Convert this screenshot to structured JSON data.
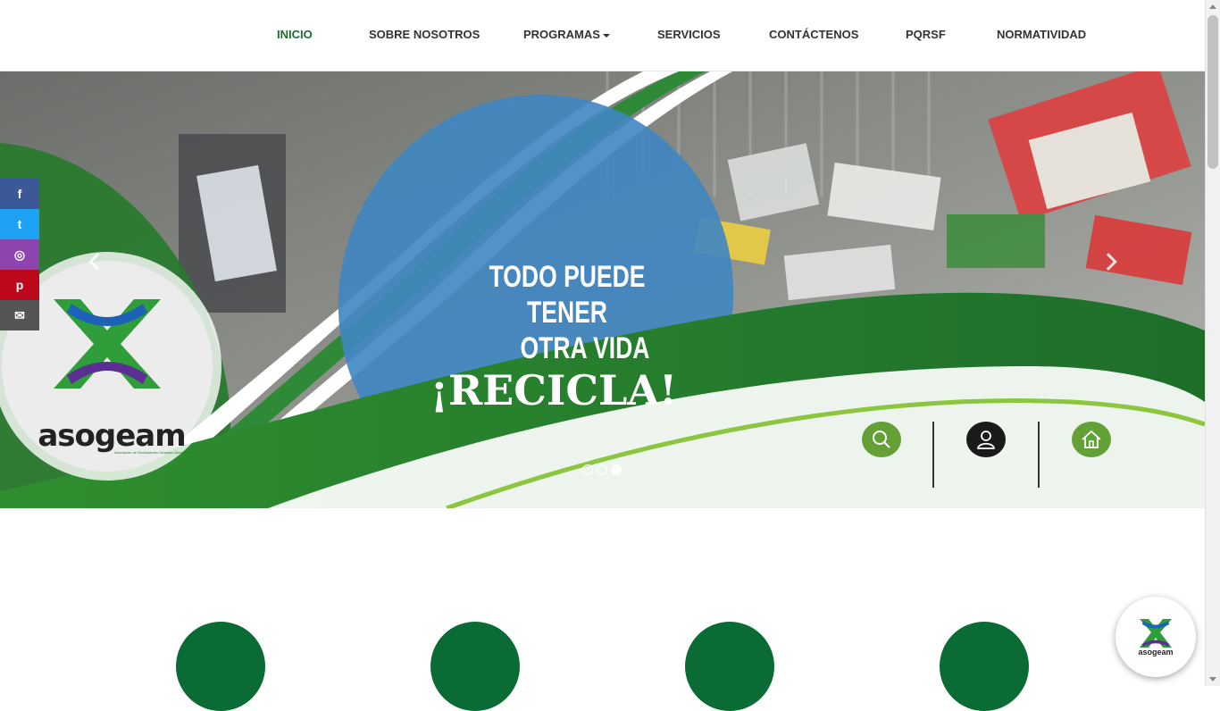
{
  "nav": {
    "items": [
      {
        "label": "INICIO",
        "active": true
      },
      {
        "label": "SOBRE NOSOTROS"
      },
      {
        "label": "PROGRAMAS",
        "dropdown": true
      },
      {
        "label": "SERVICIOS"
      },
      {
        "label": "CONTÁCTENOS"
      },
      {
        "label": "PQRSF"
      },
      {
        "label": "NORMATIVIDAD"
      }
    ]
  },
  "hero": {
    "line1": "TODO PUEDE TENER",
    "line2": "OTRA VIDA",
    "line3": "¡RECICLA!",
    "logo_text": "asogeam",
    "logo_subtitle": "Asociación de Recicladores Gestores Ambientales",
    "slides": 3,
    "active_slide": 3
  },
  "social": [
    {
      "icon": "facebook-icon",
      "glyph": "f",
      "color": "#3b5998"
    },
    {
      "icon": "twitter-icon",
      "glyph": "t",
      "color": "#1da1f2"
    },
    {
      "icon": "instagram-icon",
      "glyph": "◎",
      "color": "#8e44ad"
    },
    {
      "icon": "pinterest-icon",
      "glyph": "p",
      "color": "#bd081c"
    },
    {
      "icon": "email-icon",
      "glyph": "✉",
      "color": "#555555"
    }
  ],
  "quick_buttons": [
    "search-icon",
    "user-icon",
    "home-icon"
  ],
  "badge": {
    "text": "asogeam"
  },
  "colors": {
    "brand_green": "#0a6b34",
    "accent_green": "#63a035",
    "nav_active": "#1b6b33"
  }
}
